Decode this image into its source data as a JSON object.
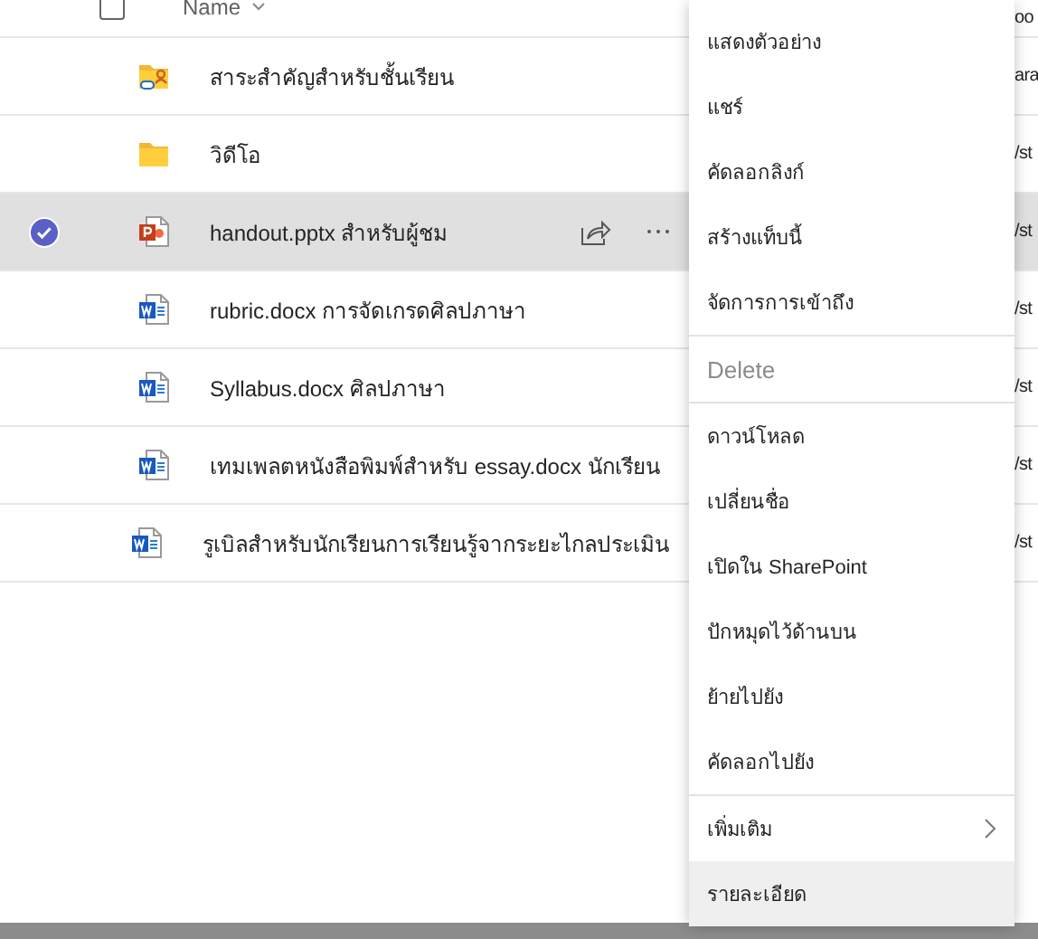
{
  "header": {
    "checked": false,
    "name_label": "Name",
    "column_3": "oo"
  },
  "rows": [
    {
      "kind": "shared_folder",
      "name": "สาระสำคัญสำหรับชั้นเรียน",
      "column_3": "ara",
      "selected": false
    },
    {
      "kind": "folder",
      "name": "วิดีโอ",
      "column_3": "/st",
      "selected": false
    },
    {
      "kind": "pptx",
      "name": "handout.pptx สำหรับผู้ชม",
      "column_3": "/st",
      "selected": true
    },
    {
      "kind": "docx",
      "name": "rubric.docx การจัดเกรดศิลปภาษา",
      "column_3": "/st",
      "selected": false
    },
    {
      "kind": "docx",
      "name": "Syllabus.docx ศิลปภาษา",
      "column_3": "/st",
      "selected": false
    },
    {
      "kind": "docx",
      "name": "เทมเพลตหนังสือพิมพ์สำหรับ essay.docx นักเรียน",
      "column_3": "/st",
      "selected": false
    },
    {
      "kind": "docx",
      "name": "รูเบิลสำหรับนักเรียนการเรียนรู้จากระยะไกลประเมิน",
      "column_3": "/st",
      "selected": false
    }
  ],
  "context_menu": [
    {
      "label": "แสดงตัวอย่าง",
      "divider_before": false,
      "disabled": false,
      "submenu": false,
      "selected": false
    },
    {
      "label": "แชร์",
      "divider_before": false,
      "disabled": false,
      "submenu": false,
      "selected": false
    },
    {
      "label": "คัดลอกลิงก์",
      "divider_before": false,
      "disabled": false,
      "submenu": false,
      "selected": false
    },
    {
      "label": "สร้างแท็บนี้",
      "divider_before": false,
      "disabled": false,
      "submenu": false,
      "selected": false
    },
    {
      "label": "จัดการการเข้าถึง",
      "divider_before": false,
      "disabled": false,
      "submenu": false,
      "selected": false
    },
    {
      "label": "Delete",
      "divider_before": true,
      "disabled": true,
      "submenu": false,
      "selected": false
    },
    {
      "label": "ดาวน์โหลด",
      "divider_before": true,
      "disabled": false,
      "submenu": false,
      "selected": false
    },
    {
      "label": "เปลี่ยนชื่อ",
      "divider_before": false,
      "disabled": false,
      "submenu": false,
      "selected": false
    },
    {
      "label": "เปิดใน SharePoint",
      "divider_before": false,
      "disabled": false,
      "submenu": false,
      "selected": false
    },
    {
      "label": "ปักหมุดไว้ด้านบน",
      "divider_before": false,
      "disabled": false,
      "submenu": false,
      "selected": false
    },
    {
      "label": "ย้ายไปยัง",
      "divider_before": false,
      "disabled": false,
      "submenu": false,
      "selected": false
    },
    {
      "label": "คัดลอกไปยัง",
      "divider_before": false,
      "disabled": false,
      "submenu": false,
      "selected": false
    },
    {
      "label": "เพิ่มเติม",
      "divider_before": true,
      "disabled": false,
      "submenu": true,
      "selected": false
    },
    {
      "label": "รายละเอียด",
      "divider_before": false,
      "disabled": false,
      "submenu": false,
      "selected": true
    }
  ]
}
